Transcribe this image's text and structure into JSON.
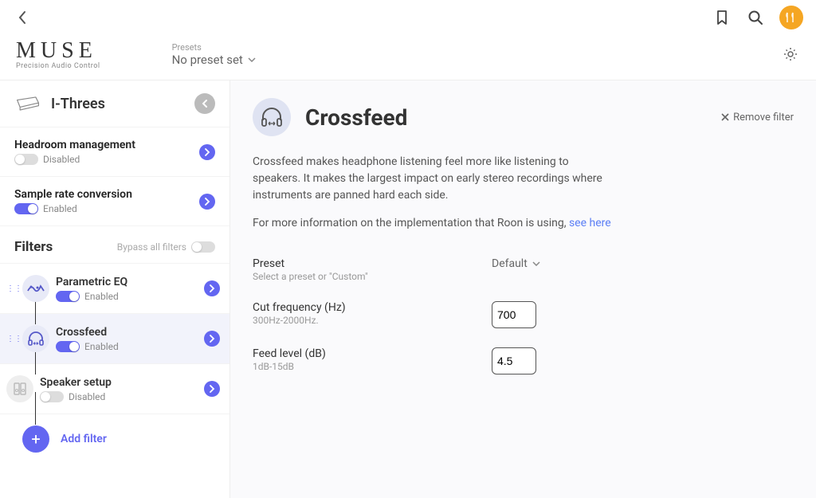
{
  "logo": {
    "title": "MUSE",
    "subtitle": "Precision Audio Control"
  },
  "presets": {
    "label": "Presets",
    "value": "No preset set"
  },
  "device": {
    "name": "I-Threes"
  },
  "settings": {
    "headroom": {
      "title": "Headroom management",
      "status": "Disabled",
      "enabled": false
    },
    "src": {
      "title": "Sample rate conversion",
      "status": "Enabled",
      "enabled": true
    }
  },
  "filters": {
    "heading": "Filters",
    "bypass_label": "Bypass all filters",
    "items": [
      {
        "name": "Parametric EQ",
        "status": "Enabled",
        "enabled": true,
        "active": false,
        "icon": "wave"
      },
      {
        "name": "Crossfeed",
        "status": "Enabled",
        "enabled": true,
        "active": true,
        "icon": "headphones"
      },
      {
        "name": "Speaker setup",
        "status": "Disabled",
        "enabled": false,
        "active": false,
        "icon": "speakers"
      }
    ],
    "add_label": "Add filter"
  },
  "content": {
    "title": "Crossfeed",
    "remove_label": "Remove filter",
    "description": "Crossfeed makes headphone listening feel more like listening to speakers. It makes the largest impact on early stereo recordings where instruments are panned hard each side.",
    "more_info_prefix": "For more information on the implementation that Roon is using, ",
    "more_info_link": "see here",
    "params": {
      "preset": {
        "label": "Preset",
        "sub": "Select a preset or \"Custom\"",
        "value": "Default"
      },
      "cut": {
        "label": "Cut frequency (Hz)",
        "sub": "300Hz-2000Hz.",
        "value": "700"
      },
      "feed": {
        "label": "Feed level (dB)",
        "sub": "1dB-15dB",
        "value": "4.5"
      }
    }
  }
}
